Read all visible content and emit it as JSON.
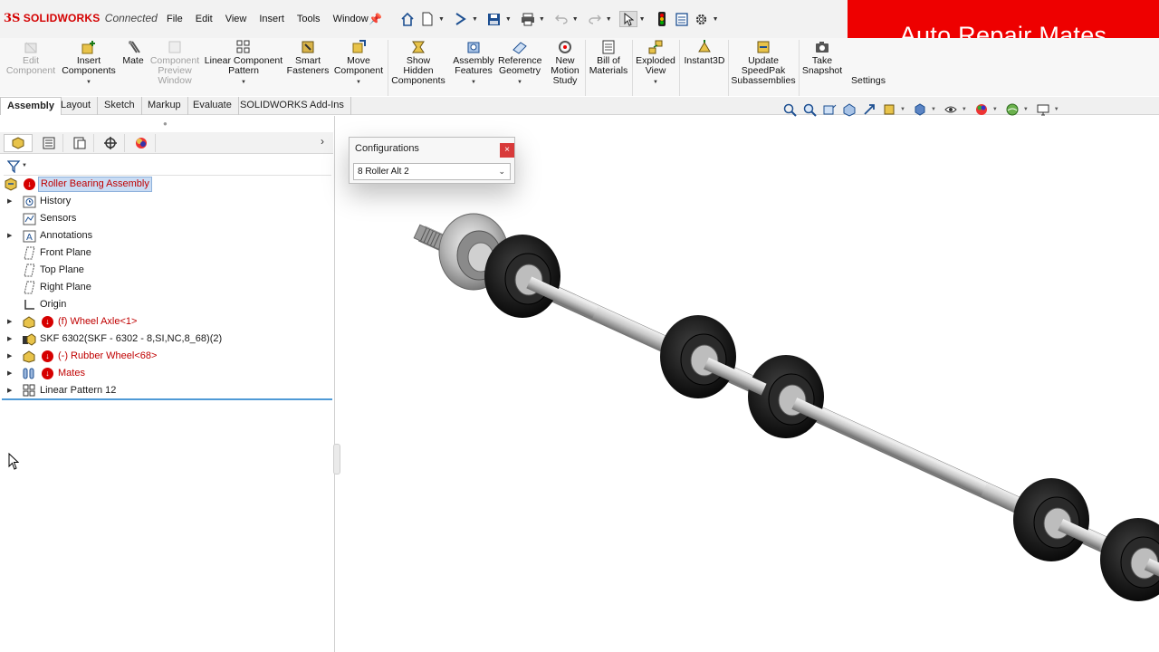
{
  "app": {
    "logo_mark": "3S",
    "logo_name": "SOLIDWORKS",
    "logo_suffix": "Connected"
  },
  "menus": [
    "File",
    "Edit",
    "View",
    "Insert",
    "Tools",
    "Window"
  ],
  "banner": {
    "title": "Auto Repair Mates"
  },
  "commands": [
    {
      "lines": [
        "Edit",
        "Component"
      ],
      "disabled": true,
      "icon": "edit-component-icon"
    },
    {
      "lines": [
        "Insert",
        "Components"
      ],
      "disabled": false,
      "icon": "insert-components-icon"
    },
    {
      "lines": [
        "Mate"
      ],
      "disabled": false,
      "icon": "mate-icon"
    },
    {
      "lines": [
        "Component",
        "Preview",
        "Window"
      ],
      "disabled": true,
      "icon": "component-preview-icon"
    },
    {
      "lines": [
        "Linear Component",
        "Pattern"
      ],
      "disabled": false,
      "icon": "linear-pattern-icon"
    },
    {
      "lines": [
        "Smart",
        "Fasteners"
      ],
      "disabled": false,
      "icon": "smart-fasteners-icon"
    },
    {
      "lines": [
        "Move",
        "Component"
      ],
      "disabled": false,
      "icon": "move-component-icon"
    },
    {
      "lines": [
        "Show",
        "Hidden",
        "Components"
      ],
      "disabled": false,
      "icon": "show-hidden-icon"
    },
    {
      "lines": [
        "Assembly",
        "Features"
      ],
      "disabled": false,
      "icon": "assembly-features-icon"
    },
    {
      "lines": [
        "Reference",
        "Geometry"
      ],
      "disabled": false,
      "icon": "reference-geometry-icon"
    },
    {
      "lines": [
        "New",
        "Motion",
        "Study"
      ],
      "disabled": false,
      "icon": "motion-study-icon"
    },
    {
      "lines": [
        "Bill of",
        "Materials"
      ],
      "disabled": false,
      "icon": "bill-of-materials-icon"
    },
    {
      "lines": [
        "Exploded",
        "View"
      ],
      "disabled": false,
      "icon": "exploded-view-icon"
    },
    {
      "lines": [
        "Instant3D"
      ],
      "disabled": false,
      "icon": "instant3d-icon"
    },
    {
      "lines": [
        "Update",
        "SpeedPak",
        "Subassemblies"
      ],
      "disabled": false,
      "icon": "speedpak-icon"
    },
    {
      "lines": [
        "Take",
        "Snapshot"
      ],
      "disabled": false,
      "icon": "snapshot-icon"
    },
    {
      "lines": [
        "Settings"
      ],
      "disabled": false,
      "icon": "assembly-settings-icon"
    }
  ],
  "tabs": [
    "Assembly",
    "Layout",
    "Sketch",
    "Markup",
    "Evaluate",
    "SOLIDWORKS Add-Ins"
  ],
  "active_tab": "Assembly",
  "tree": [
    {
      "label": "Roller Bearing Assembly",
      "icon": "assembly-icon",
      "error": true,
      "color": "red",
      "expand": false,
      "selected": true
    },
    {
      "label": "History",
      "icon": "history-icon",
      "error": false,
      "color": "black",
      "expand": true
    },
    {
      "label": "Sensors",
      "icon": "sensors-icon",
      "error": false,
      "color": "black",
      "expand": false
    },
    {
      "label": "Annotations",
      "icon": "annotations-icon",
      "error": false,
      "color": "black",
      "expand": true
    },
    {
      "label": "Front Plane",
      "icon": "plane-icon",
      "error": false,
      "color": "black",
      "expand": false
    },
    {
      "label": "Top Plane",
      "icon": "plane-icon",
      "error": false,
      "color": "black",
      "expand": false
    },
    {
      "label": "Right Plane",
      "icon": "plane-icon",
      "error": false,
      "color": "black",
      "expand": false
    },
    {
      "label": "Origin",
      "icon": "origin-icon",
      "error": false,
      "color": "black",
      "expand": false
    },
    {
      "label": "(f) Wheel Axle<1>",
      "icon": "part-icon",
      "error": true,
      "color": "red",
      "expand": true
    },
    {
      "label": "SKF 6302(SKF - 6302 - 8,SI,NC,8_68)(2)",
      "icon": "subassembly-icon",
      "error": false,
      "color": "black",
      "expand": true
    },
    {
      "label": "(-) Rubber Wheel<68>",
      "icon": "part-icon",
      "error": true,
      "color": "red",
      "expand": true
    },
    {
      "label": "Mates",
      "icon": "mates-icon",
      "error": true,
      "color": "red",
      "expand": true
    },
    {
      "label": "Linear Pattern 12",
      "icon": "linear-pattern-icon",
      "error": false,
      "color": "black",
      "expand": true
    }
  ],
  "configurations": {
    "title": "Configurations",
    "close": "×",
    "selected": "8 Roller Alt 2"
  },
  "colors": {
    "banner": "#ee0000",
    "error": "#d60000",
    "selection": "#c9dcf4",
    "accent_line": "#4f9ad6"
  }
}
